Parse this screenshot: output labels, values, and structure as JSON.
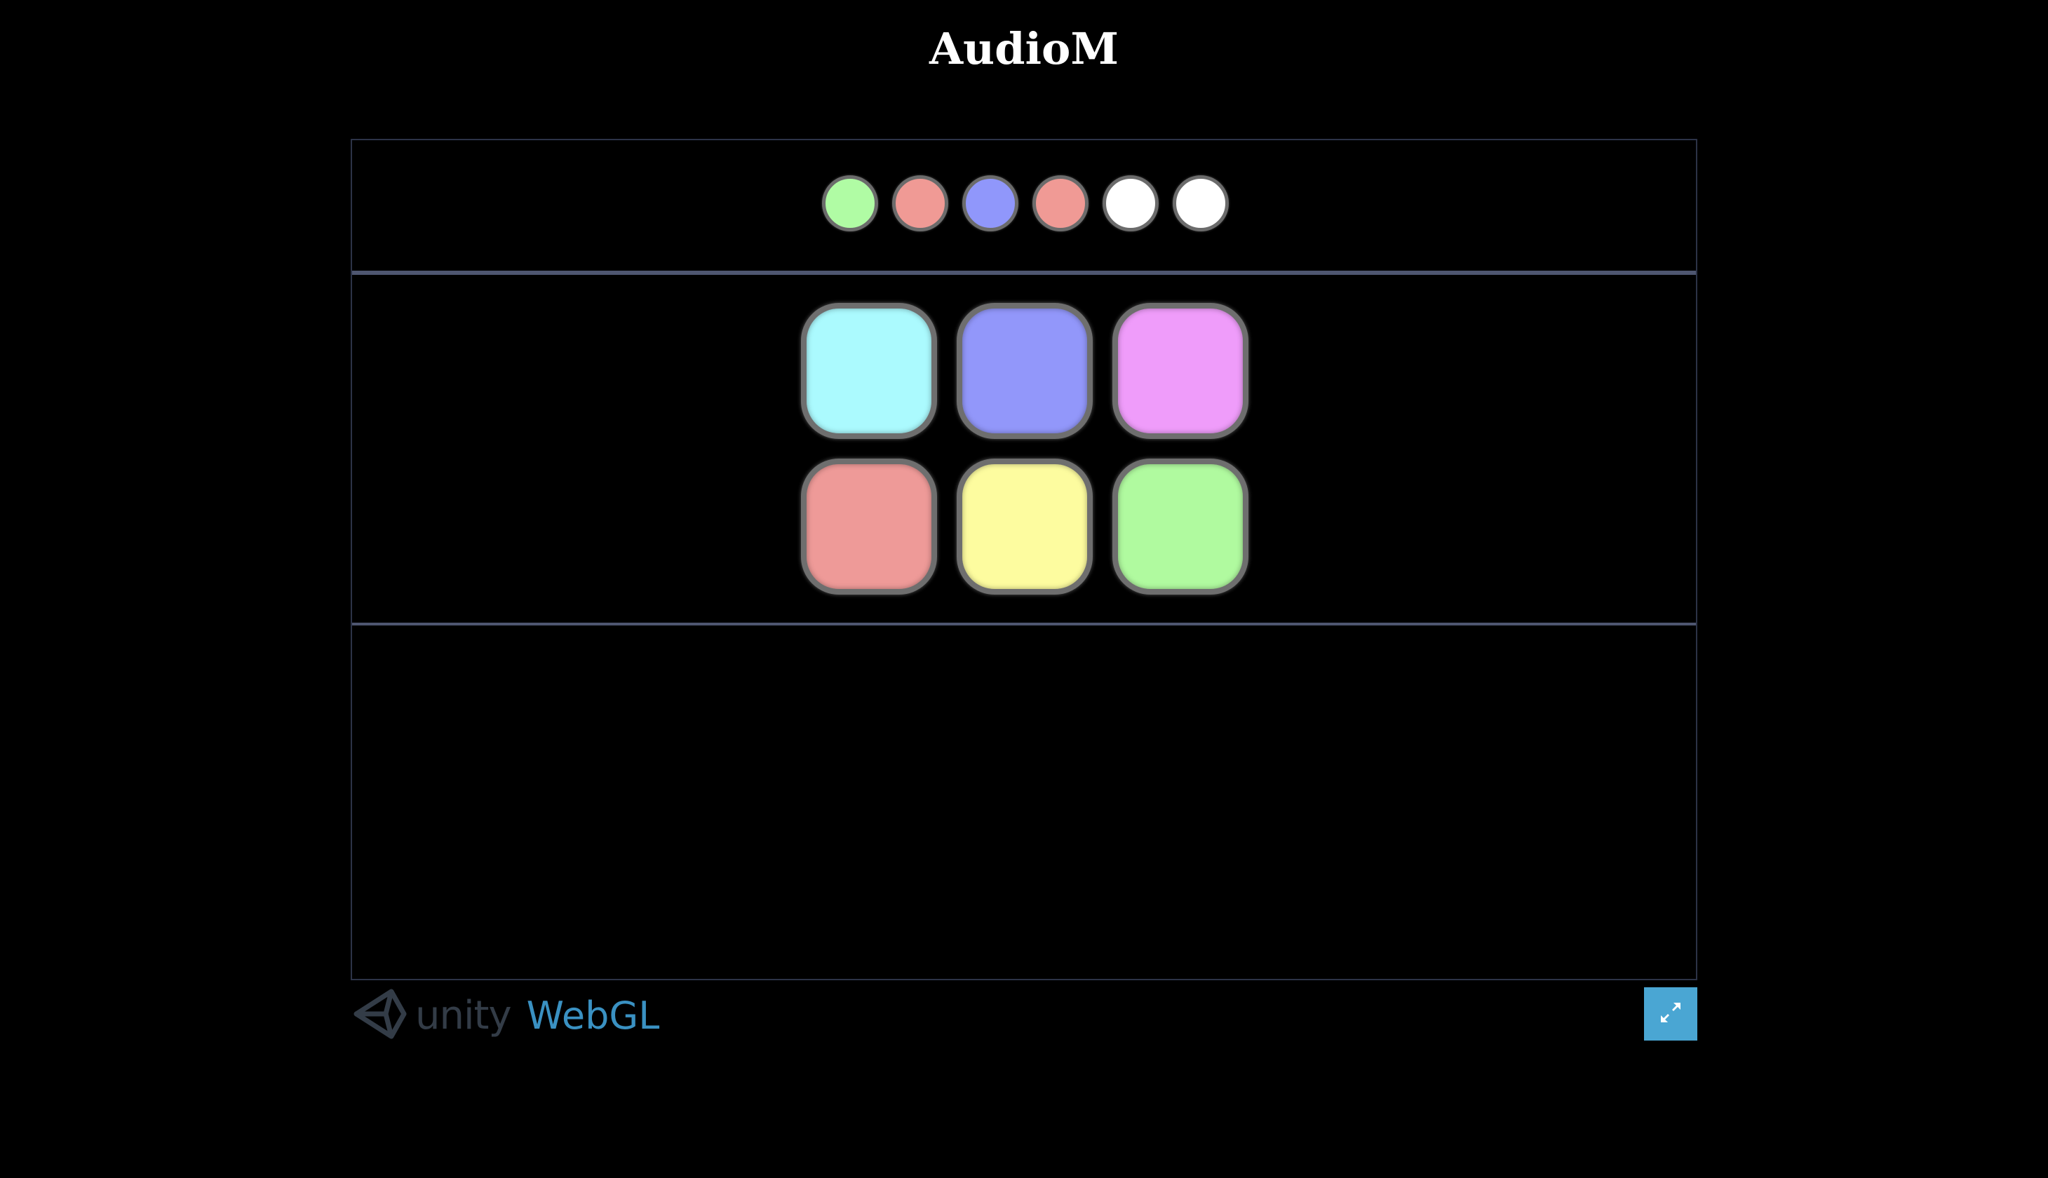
{
  "page": {
    "title": "AudioM"
  },
  "game": {
    "indicator_dots": [
      {
        "name": "dot-1",
        "color": "#b0fca4"
      },
      {
        "name": "dot-2",
        "color": "#f09a95"
      },
      {
        "name": "dot-3",
        "color": "#9097fb"
      },
      {
        "name": "dot-4",
        "color": "#f09a95"
      },
      {
        "name": "dot-5",
        "color": "#ffffff"
      },
      {
        "name": "dot-6",
        "color": "#ffffff"
      }
    ],
    "pads": [
      {
        "name": "pad-cyan",
        "color": "#abfafe"
      },
      {
        "name": "pad-blue",
        "color": "#9297fa"
      },
      {
        "name": "pad-magenta",
        "color": "#ef9cfa"
      },
      {
        "name": "pad-red",
        "color": "#ee9a98"
      },
      {
        "name": "pad-yellow",
        "color": "#fdfc9f"
      },
      {
        "name": "pad-green",
        "color": "#b0fa9f"
      }
    ]
  },
  "footer": {
    "logo_unity": "unity",
    "logo_webgl": "WebGL",
    "logo_icon": "unity-logo-icon",
    "fullscreen_icon": "fullscreen-expand-icon"
  },
  "colors": {
    "background": "#000000",
    "panel_border": "#4e5670",
    "accent": "#4aa6d3"
  }
}
